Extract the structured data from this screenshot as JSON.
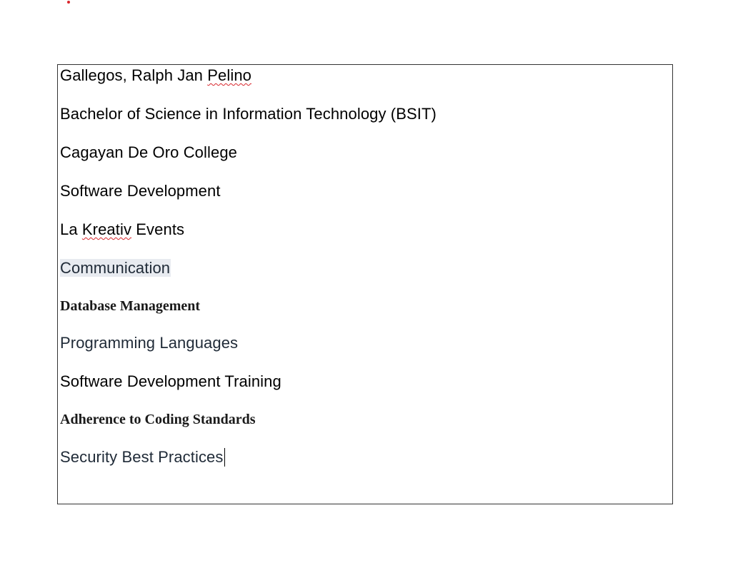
{
  "document": {
    "lines": {
      "name_last_first": "Gallegos, Ralph Jan ",
      "name_misspelled": "Pelino",
      "degree": "Bachelor of Science in Information Technology (BSIT)",
      "school": "Cagayan De Oro College",
      "field": "Software Development",
      "company_prefix": "La ",
      "company_misspelled": "Kreativ",
      "company_suffix": " Events",
      "skill_communication": "Communication",
      "skill_database": "Database Management",
      "skill_programming": "Programming Languages",
      "skill_training": "Software Development Training",
      "skill_standards": "Adherence to Coding Standards",
      "skill_security": "Security Best Practices"
    }
  },
  "colors": {
    "border": "#333333",
    "spellcheck": "#d9262c",
    "selection_highlight": "#e8ebf0"
  }
}
